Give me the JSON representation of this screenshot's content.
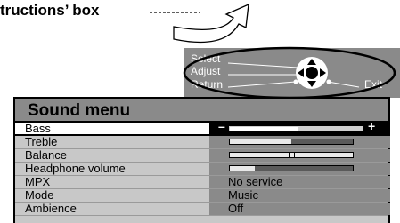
{
  "caption": "tructions’ box",
  "hint": {
    "select": "Select",
    "adjust": "Adjust",
    "return": "Return",
    "exit": "Exit"
  },
  "menu": {
    "title": "Sound menu",
    "minus": "–",
    "plus": "+",
    "rows": [
      {
        "label": "Bass",
        "type": "bar",
        "level": 0.52,
        "active": true
      },
      {
        "label": "Treble",
        "type": "bar",
        "level": 0.5
      },
      {
        "label": "Balance",
        "type": "knob",
        "level": 0.5
      },
      {
        "label": "Headphone volume",
        "type": "bar",
        "level": 0.2
      },
      {
        "label": "MPX",
        "type": "text",
        "value": "No service"
      },
      {
        "label": "Mode",
        "type": "text",
        "value": "Music"
      },
      {
        "label": "Ambience",
        "type": "text",
        "value": "Off"
      }
    ]
  }
}
